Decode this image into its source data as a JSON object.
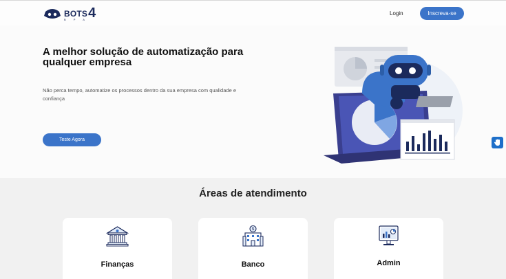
{
  "header": {
    "logo_text": "BOTS",
    "logo_number": "4",
    "logo_subtext": "B P A",
    "login_label": "Login",
    "signup_label": "Inscreva-se"
  },
  "hero": {
    "title": "A melhor solução de automatização para qualquer empresa",
    "description": "Não perca tempo, automatize os processos dentro da sua empresa com qualidade e confiança",
    "cta_label": "Teste Agora"
  },
  "areas": {
    "title": "Áreas de atendimento",
    "cards": [
      {
        "label": "Finanças",
        "icon": "bank-building-icon"
      },
      {
        "label": "Banco",
        "icon": "bank-office-icon"
      },
      {
        "label": "Admin",
        "icon": "monitor-chart-icon"
      }
    ]
  },
  "colors": {
    "primary": "#3b74c9",
    "navy": "#1b2a5c",
    "section_bg": "#f1f1f1"
  }
}
